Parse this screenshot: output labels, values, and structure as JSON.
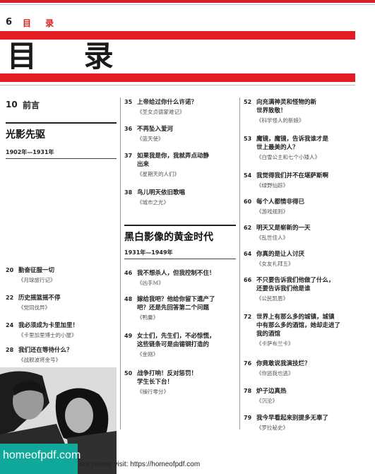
{
  "header": {
    "page_number": "6",
    "section_label": "目 录",
    "main_title": "目 录"
  },
  "preface": {
    "num": "10",
    "label": "前言"
  },
  "sections": [
    {
      "title": "光影先驱",
      "years": "1902年—1931年"
    },
    {
      "title": "黑白影像的黄金时代",
      "years": "1931年—1949年"
    }
  ],
  "col1": [
    {
      "num": "20",
      "title": "勤奋征服一切",
      "sub": "《月球旅行记》"
    },
    {
      "num": "22",
      "title": "历史摇篮摇不停",
      "sub": "《党同伐异》"
    },
    {
      "num": "24",
      "title": "我必须成为卡里加里！",
      "sub": "《卡里加里博士的小屋》"
    },
    {
      "num": "28",
      "title": "我们还在等待什么？",
      "sub": "《战舰波将金号》"
    },
    {
      "num": "30",
      "title": "这首夫妻之歌或许从未响起，\n又或许时时唱起",
      "sub": "《日出》"
    },
    {
      "num": "32",
      "title": "劳力者岂知劳心者之志",
      "sub": "《大都会》"
    },
    {
      "num": "34",
      "title": "如果你把脑子里想的都些说\n出来，我就掐死你",
      "sub": "《船长二世》"
    }
  ],
  "col2": [
    {
      "num": "35",
      "title": "上帝给过你什么许诺？",
      "sub": "《圣女贞德蒙难记》"
    },
    {
      "num": "36",
      "title": "不再坠入爱河",
      "sub": "《蓝天使》"
    },
    {
      "num": "37",
      "title": "如果我是你，我就弄点动静\n出来",
      "sub": "《星期天的人们》"
    },
    {
      "num": "38",
      "title": "鸟儿明天依旧歌唱",
      "sub": "《城市之光》"
    },
    {
      "num": "46",
      "title": "我不想杀人，但我控制不住！",
      "sub": "《凶手M》"
    },
    {
      "num": "48",
      "title": "嫁给我吧？他给你留下遗产了\n吧？还是先回答第二个问题",
      "sub": "《鸭羹》"
    },
    {
      "num": "49",
      "title": "女士们，先生们，不必惊慌，\n这些链条可是由锡钢打造的",
      "sub": "《金刚》"
    },
    {
      "num": "50",
      "title": "战争打响！反对惩罚！\n学生长下台！",
      "sub": "《操行零分》"
    }
  ],
  "col3": [
    {
      "num": "52",
      "title": "向充满神灵和怪物的新\n世界致敬！",
      "sub": "《科学怪人的新娘》"
    },
    {
      "num": "53",
      "title": "魔镜，魔镜，告诉我谁才是\n世上最美的人？",
      "sub": "《白雪公主和七个小矮人》"
    },
    {
      "num": "54",
      "title": "我觉得我们并不在堪萨斯啊",
      "sub": "《绿野仙踪》"
    },
    {
      "num": "60",
      "title": "每个人都情非得已",
      "sub": "《游戏规则》"
    },
    {
      "num": "62",
      "title": "明天又是崭新的一天",
      "sub": "《乱世佳人》"
    },
    {
      "num": "64",
      "title": "你真的是让人讨厌",
      "sub": "《女友礼拜五》"
    },
    {
      "num": "66",
      "title": "不只要告诉我们他做了什么，\n还要告诉我们他是谁",
      "sub": "《公民凯恩》"
    },
    {
      "num": "72",
      "title": "世界上有那么多的城镇，城镇\n中有那么多的酒馆，她却走进了\n我的酒馆",
      "sub": "《卡萨布兰卡》"
    },
    {
      "num": "76",
      "title": "你竟敢说我演技烂？",
      "sub": "《你逃我也逃》"
    },
    {
      "num": "78",
      "title": "炉子边真热",
      "sub": "《沉沦》"
    },
    {
      "num": "79",
      "title": "我今早看起来别提多无辜了",
      "sub": "《罗拉秘史》"
    }
  ],
  "watermark": {
    "logo": "homeofpdf.com",
    "note": "ore please visit: https://homeofpdf.com"
  },
  "colors": {
    "accent_red": "#e31b23",
    "logo_teal": "#10a89a"
  }
}
